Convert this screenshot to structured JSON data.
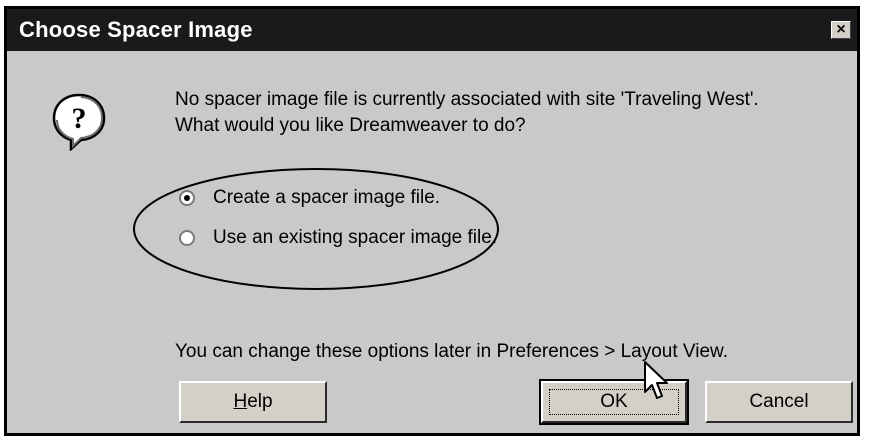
{
  "dialog": {
    "title": "Choose Spacer Image",
    "close_label": "×"
  },
  "message": {
    "line1": "No spacer image file is currently associated with site 'Traveling West'.",
    "line2": "What would you like Dreamweaver to do?"
  },
  "options": [
    {
      "label": "Create a spacer image file.",
      "selected": true
    },
    {
      "label": "Use an existing spacer image file.",
      "selected": false
    }
  ],
  "hint": "You can change these options later in Preferences > Layout View.",
  "buttons": {
    "help_mnemonic": "H",
    "help_rest": "elp",
    "ok": "OK",
    "cancel": "Cancel"
  },
  "icons": {
    "question": "question-bubble-icon",
    "close": "close-icon",
    "cursor": "mouse-pointer-icon"
  }
}
